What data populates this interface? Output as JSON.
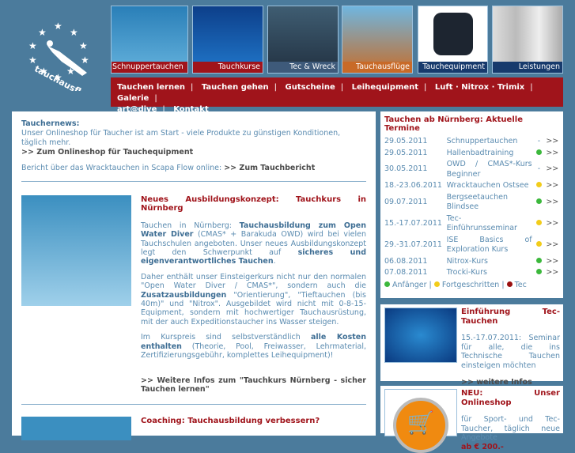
{
  "logo": {
    "text": "tauchausflug.eu"
  },
  "tiles": [
    {
      "label": "Schnuppertauchen",
      "color": "#a0141b"
    },
    {
      "label": "Tauchkurse",
      "color": "#a0141b"
    },
    {
      "label": "Tec & Wreck",
      "color": "#3e5a7a"
    },
    {
      "label": "Tauchausflüge",
      "color": "#c86a28"
    },
    {
      "label": "Tauchequipment",
      "color": "#173a6c"
    },
    {
      "label": "Leistungen",
      "color": "#173a6c"
    }
  ],
  "nav": [
    "Tauchen lernen",
    "Tauchen gehen",
    "Gutscheine",
    "Leihequipment",
    "Luft · Nitrox · Trimix",
    "Galerie",
    "art@dive",
    "Kontakt"
  ],
  "news": {
    "title": "Tauchernews:",
    "line1": "Unser Onlineshop für Taucher ist am Start - viele Produkte zu günstigen Konditionen, täglich mehr.",
    "link1": ">> Zum Onlineshop für Tauchequipment",
    "line2": "Bericht über das Wracktauchen in Scapa Flow online:",
    "link2": ">> Zum Tauchbericht"
  },
  "article1": {
    "title": "Neues Ausbildungskonzept: Tauchkurs in Nürnberg",
    "p1a": "Tauchen in Nürnberg:",
    "p1b": "Tauchausbildung zum Open Water Diver",
    "p1c": "(CMAS* + Barakuda OWD) wird bei vielen Tauchschulen angeboten. Unser neues Ausbildungskonzept legt den Schwerpunkt auf",
    "p1d": "sicheres und eigenverantwortliches Tauchen",
    "p2a": "Daher enthält unser Einsteigerkurs nicht nur den normalen \"Open Water Diver / CMAS*\", sondern auch die",
    "p2b": "Zusatzausbildungen",
    "p2c": "\"Orientierung\", \"Tieftauchen (bis 40m)\" und \"Nitrox\". Ausgebildet wird nicht mit 0-8-15-Equipment, sondern mit hochwertiger Tauchausrüstung, mit der auch Expeditionstaucher ins Wasser steigen.",
    "p3a": "Im Kurspreis sind selbstverständlich",
    "p3b": "alle Kosten enthalten",
    "p3c": "(Theorie, Pool, Freiwasser, Lehrmaterial, Zertifizierungsgebühr, komplettes Leihequipment)!",
    "link": ">> Weitere Infos zum \"Tauchkurs Nürnberg - sicher Tauchen lernen\""
  },
  "article2": {
    "title": "Coaching: Tauchausbildung verbessern?"
  },
  "termine": {
    "title": "Tauchen ab Nürnberg: Aktuelle Termine",
    "more": ">>",
    "rows": [
      {
        "date": "29.05.2011",
        "name": "Schnuppertauchen",
        "level": "-"
      },
      {
        "date": "29.05.2011",
        "name": "Hallenbadtraining",
        "level": "green"
      },
      {
        "date": "30.05.2011",
        "name": "OWD / CMAS*-Kurs Beginner",
        "level": "-"
      },
      {
        "date": "18.-23.06.2011",
        "name": "Wracktauchen Ostsee",
        "level": "yellow"
      },
      {
        "date": "09.07.2011",
        "name": "Bergseetauchen Blindsee",
        "level": "green"
      },
      {
        "date": "15.-17.07.2011",
        "name": "Tec-Einführunsseminar",
        "level": "yellow"
      },
      {
        "date": "29.-31.07.2011",
        "name": "ISE Basics of Exploration Kurs",
        "level": "yellow"
      },
      {
        "date": "06.08.2011",
        "name": "Nitrox-Kurs",
        "level": "green"
      },
      {
        "date": "07.08.2011",
        "name": "Trocki-Kurs",
        "level": "green"
      }
    ],
    "legend": [
      {
        "label": "Anfänger",
        "color": "#3cb83c"
      },
      {
        "label": "Fortgeschritten",
        "color": "#f2cc1a"
      },
      {
        "label": "Tec",
        "color": "#9a1010"
      }
    ]
  },
  "tec": {
    "title": "Einführung Tec-Tauchen",
    "text": "15.-17.07.2011: Seminar für alle, die ins Technische Tauchen einsteigen möchten",
    "link": ">> weitere Infos"
  },
  "shop": {
    "title": "NEU: Unser Onlineshop",
    "text": "für Sport- und Tec-Taucher, täglich neue Angebote",
    "price": "ab € 200.-"
  }
}
